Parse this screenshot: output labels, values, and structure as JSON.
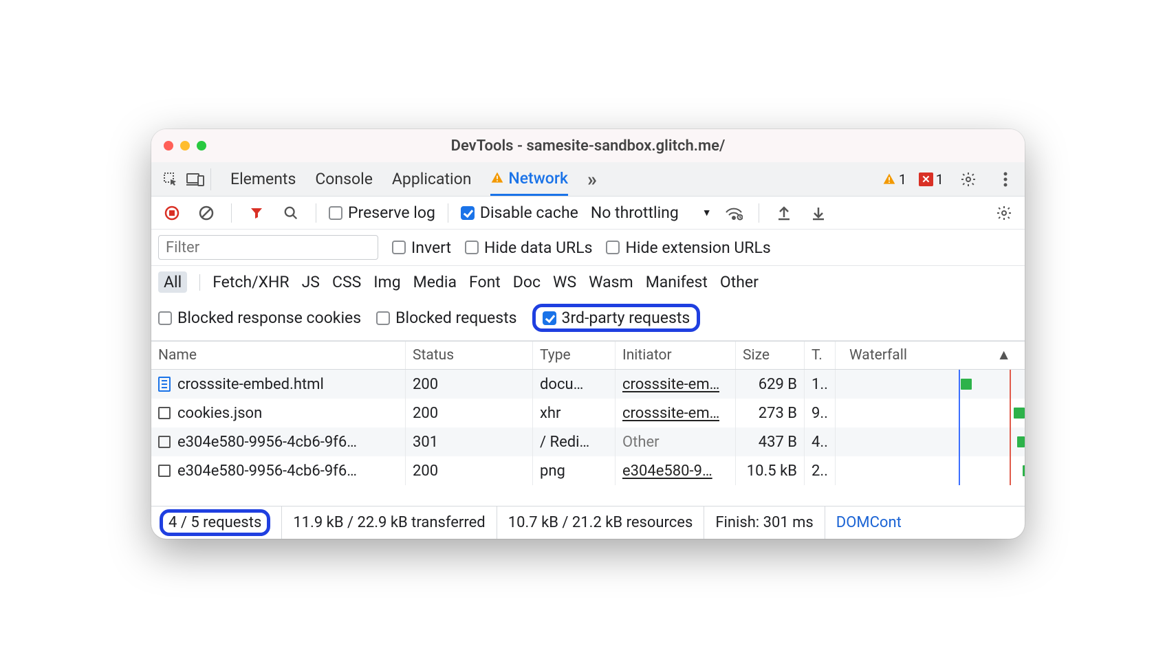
{
  "window": {
    "title": "DevTools - samesite-sandbox.glitch.me/"
  },
  "tabs": {
    "items": [
      "Elements",
      "Console",
      "Application",
      "Network"
    ],
    "activeIndex": 3,
    "warnCount": "1",
    "errCount": "1"
  },
  "toolbar": {
    "preserve_log": "Preserve log",
    "disable_cache": "Disable cache",
    "no_throttling": "No throttling"
  },
  "filter": {
    "placeholder": "Filter",
    "invert": "Invert",
    "hide_data": "Hide data URLs",
    "hide_ext": "Hide extension URLs"
  },
  "types": [
    "All",
    "Fetch/XHR",
    "JS",
    "CSS",
    "Img",
    "Media",
    "Font",
    "Doc",
    "WS",
    "Wasm",
    "Manifest",
    "Other"
  ],
  "blocked": {
    "cookies": "Blocked response cookies",
    "requests": "Blocked requests",
    "third": "3rd-party requests"
  },
  "table": {
    "headers": {
      "name": "Name",
      "status": "Status",
      "type": "Type",
      "initiator": "Initiator",
      "size": "Size",
      "time": "T.",
      "waterfall": "Waterfall"
    },
    "rows": [
      {
        "icon": "doc",
        "name": "crosssite-embed.html",
        "status": "200",
        "type": "docu…",
        "initiator": "crosssite-em…",
        "initiator_kind": "link",
        "size": "629 B",
        "time": "1..",
        "wf": {
          "left": "66%",
          "width": "6%"
        }
      },
      {
        "icon": "box",
        "name": "cookies.json",
        "status": "200",
        "type": "xhr",
        "initiator": "crosssite-em…",
        "initiator_kind": "link",
        "size": "273 B",
        "time": "9..",
        "wf": {
          "left": "94%",
          "width": "6%"
        }
      },
      {
        "icon": "box",
        "name": "e304e580-9956-4cb6-9f6…",
        "status": "301",
        "type": "/ Redi…",
        "initiator": "Other",
        "initiator_kind": "other",
        "size": "437 B",
        "time": "4..",
        "wf": {
          "left": "96%",
          "width": "4%"
        }
      },
      {
        "icon": "box",
        "name": "e304e580-9956-4cb6-9f6…",
        "status": "200",
        "type": "png",
        "initiator": "e304e580-9…",
        "initiator_kind": "link",
        "size": "10.5 kB",
        "time": "2..",
        "wf": {
          "left": "99%",
          "width": "3%"
        }
      }
    ]
  },
  "status": {
    "requests": "4 / 5 requests",
    "transferred": "11.9 kB / 22.9 kB transferred",
    "resources": "10.7 kB / 21.2 kB resources",
    "finish": "Finish: 301 ms",
    "dom": "DOMCont"
  }
}
